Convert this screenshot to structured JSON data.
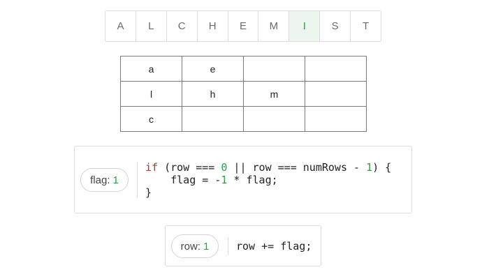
{
  "letters": [
    {
      "char": "A",
      "active": false
    },
    {
      "char": "L",
      "active": false
    },
    {
      "char": "C",
      "active": false
    },
    {
      "char": "H",
      "active": false
    },
    {
      "char": "E",
      "active": false
    },
    {
      "char": "M",
      "active": false
    },
    {
      "char": "I",
      "active": true
    },
    {
      "char": "S",
      "active": false
    },
    {
      "char": "T",
      "active": false
    }
  ],
  "grid": [
    [
      "a",
      "e",
      "",
      ""
    ],
    [
      "l",
      "h",
      "m",
      ""
    ],
    [
      "c",
      "",
      "",
      ""
    ]
  ],
  "colors": {
    "active_bg": "#edf6ee",
    "active_text": "#2f9e44",
    "keyword": "#8a4a33",
    "number": "#2f9e44"
  },
  "flag_block": {
    "var_label": "flag:",
    "var_value": "1",
    "code_lines": [
      [
        {
          "t": "if",
          "c": "kw"
        },
        {
          "t": " (row === "
        },
        {
          "t": "0",
          "c": "num"
        },
        {
          "t": " || row === numRows - "
        },
        {
          "t": "1",
          "c": "num"
        },
        {
          "t": ") {"
        }
      ],
      [
        {
          "t": "    flag = -"
        },
        {
          "t": "1",
          "c": "num"
        },
        {
          "t": " * flag;"
        }
      ],
      [
        {
          "t": "}"
        }
      ]
    ]
  },
  "row_block": {
    "var_label": "row:",
    "var_value": "1",
    "code_lines": [
      [
        {
          "t": "row += flag;"
        }
      ]
    ]
  }
}
